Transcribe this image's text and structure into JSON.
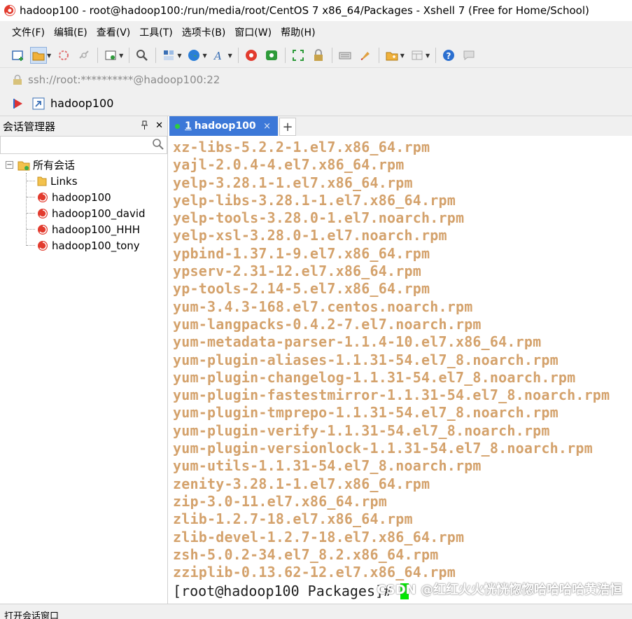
{
  "window": {
    "title": "hadoop100 - root@hadoop100:/run/media/root/CentOS 7 x86_64/Packages - Xshell 7 (Free for Home/School)"
  },
  "menu": [
    "文件(F)",
    "编辑(E)",
    "查看(V)",
    "工具(T)",
    "选项卡(B)",
    "窗口(W)",
    "帮助(H)"
  ],
  "address": {
    "text": "ssh://root:**********@hadoop100:22"
  },
  "session_bar": {
    "label": "hadoop100"
  },
  "sidebar": {
    "title": "会话管理器",
    "pin_glyph": "📌",
    "close_glyph": "✕",
    "tree": {
      "root": "所有会话",
      "children": [
        "Links",
        "hadoop100",
        "hadoop100_david",
        "hadoop100_HHH",
        "hadoop100_tony"
      ]
    }
  },
  "tab": {
    "number": "1",
    "label": "hadoop100",
    "close": "×",
    "add": "+"
  },
  "terminal": {
    "lines": [
      "xz-libs-5.2.2-1.el7.x86_64.rpm",
      "yajl-2.0.4-4.el7.x86_64.rpm",
      "yelp-3.28.1-1.el7.x86_64.rpm",
      "yelp-libs-3.28.1-1.el7.x86_64.rpm",
      "yelp-tools-3.28.0-1.el7.noarch.rpm",
      "yelp-xsl-3.28.0-1.el7.noarch.rpm",
      "ypbind-1.37.1-9.el7.x86_64.rpm",
      "ypserv-2.31-12.el7.x86_64.rpm",
      "yp-tools-2.14-5.el7.x86_64.rpm",
      "yum-3.4.3-168.el7.centos.noarch.rpm",
      "yum-langpacks-0.4.2-7.el7.noarch.rpm",
      "yum-metadata-parser-1.1.4-10.el7.x86_64.rpm",
      "yum-plugin-aliases-1.1.31-54.el7_8.noarch.rpm",
      "yum-plugin-changelog-1.1.31-54.el7_8.noarch.rpm",
      "yum-plugin-fastestmirror-1.1.31-54.el7_8.noarch.rpm",
      "yum-plugin-tmprepo-1.1.31-54.el7_8.noarch.rpm",
      "yum-plugin-verify-1.1.31-54.el7_8.noarch.rpm",
      "yum-plugin-versionlock-1.1.31-54.el7_8.noarch.rpm",
      "yum-utils-1.1.31-54.el7_8.noarch.rpm",
      "zenity-3.28.1-1.el7.x86_64.rpm",
      "zip-3.0-11.el7.x86_64.rpm",
      "zlib-1.2.7-18.el7.x86_64.rpm",
      "zlib-devel-1.2.7-18.el7.x86_64.rpm",
      "zsh-5.0.2-34.el7_8.2.x86_64.rpm",
      "zziplib-0.13.62-12.el7.x86_64.rpm"
    ],
    "prompt": "[root@hadoop100 Packages]#",
    "file_color": "#d4a26c",
    "cursor_color": "#00e600"
  },
  "watermark": "CSDN @红红火火恍恍惚惚哈哈哈哈黄浩恒",
  "status": {
    "text": "打开会话窗口"
  }
}
